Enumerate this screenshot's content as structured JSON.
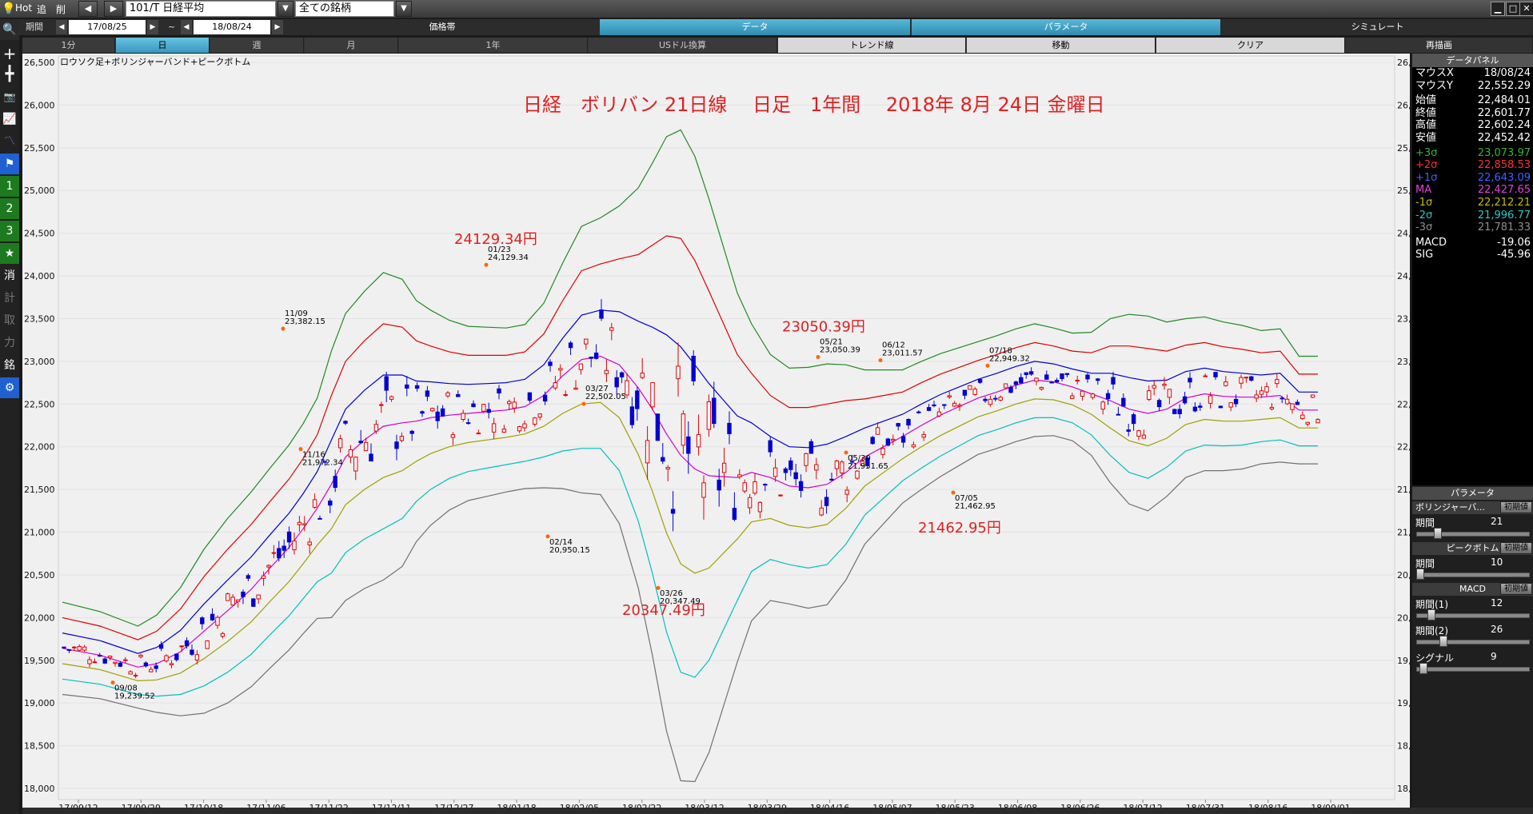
{
  "topbar": {
    "hot": "Hot",
    "add": "追",
    "del": "削",
    "code": "101/T 日経平均",
    "filter": "全ての銘柄"
  },
  "row2": {
    "period_label": "期間",
    "from_date": "17/08/25",
    "tilde": "~",
    "to_date": "18/08/24",
    "tabs": [
      "価格帯",
      "データ",
      "パラメータ",
      "シミュレート"
    ]
  },
  "row3": {
    "tabs": [
      "1分",
      "日",
      "週",
      "月",
      "1年",
      "USドル換算",
      "トレンド線",
      "移動",
      "クリア",
      "再描画"
    ]
  },
  "lefttoolbar": {
    "num1": "1",
    "num2": "2",
    "num3": "3",
    "k1": "消",
    "k2": "計",
    "k3": "取",
    "k4": "力",
    "k5": "銘"
  },
  "chart_data": {
    "type": "candlestick",
    "indicator_label": "ロウソク足+ボリンジャーバンド+ピークボトム",
    "title": "日経　ボリバン 21日線　 日足　1年間 　2018年 8月 24日 金曜日",
    "y_ticks": [
      "26,500",
      "26,000",
      "25,500",
      "25,000",
      "24,500",
      "24,000",
      "23,500",
      "23,000",
      "22,500",
      "22,000",
      "21,500",
      "21,000",
      "20,500",
      "20,000",
      "19,500",
      "19,000",
      "18,500",
      "18,000"
    ],
    "ylim": [
      18000,
      26500
    ],
    "x_ticks": [
      "17/09/12",
      "17/09/29",
      "17/10/18",
      "17/11/06",
      "17/11/22",
      "17/12/11",
      "17/12/27",
      "18/01/18",
      "18/02/05",
      "18/02/22",
      "18/03/12",
      "18/03/29",
      "18/04/16",
      "18/05/07",
      "18/05/23",
      "18/06/08",
      "18/06/26",
      "18/07/12",
      "18/07/31",
      "18/08/16",
      "18/09/01"
    ],
    "series_colors": {
      "+3σ": "#1e8c1e",
      "+2σ": "#e00000",
      "+1σ": "#0000d8",
      "MA": "#d000d0",
      "-1σ": "#a0a000",
      "-2σ": "#00c0c0",
      "-3σ": "#707070"
    },
    "peaks": [
      {
        "date": "09/08",
        "value": "19,239.52"
      },
      {
        "date": "11/09",
        "value": "23,382.15"
      },
      {
        "date": "11/16",
        "value": "21,972.34"
      },
      {
        "date": "01/23",
        "value": "24,129.34"
      },
      {
        "date": "02/14",
        "value": "20,950.15"
      },
      {
        "date": "03/27",
        "value": "22,502.05"
      },
      {
        "date": "03/26",
        "value": "20,347.49"
      },
      {
        "date": "05/21",
        "value": "23,050.39"
      },
      {
        "date": "05/30",
        "value": "21,931.65"
      },
      {
        "date": "06/12",
        "value": "23,011.57"
      },
      {
        "date": "07/05",
        "value": "21,462.95"
      },
      {
        "date": "07/18",
        "value": "22,949.32"
      }
    ],
    "callouts": [
      {
        "text": "24129.34円",
        "value": 24129.34
      },
      {
        "text": "23050.39円",
        "value": 23050.39
      },
      {
        "text": "20347.49円",
        "value": 20347.49
      },
      {
        "text": "21462.95円",
        "value": 21462.95
      }
    ],
    "bands": {
      "x": [
        0,
        40,
        80,
        100,
        125,
        150,
        175,
        200,
        220,
        240,
        255,
        270,
        285,
        300,
        320,
        340,
        360,
        375,
        390,
        410,
        430,
        450,
        470,
        490,
        510,
        530,
        550,
        570,
        590,
        610,
        625,
        640,
        655,
        670,
        685,
        700,
        715,
        730,
        750,
        770,
        790,
        810,
        830,
        850,
        870,
        890,
        910,
        930,
        950,
        970,
        990,
        1010,
        1030,
        1050,
        1070,
        1090,
        1110,
        1130,
        1150,
        1170,
        1190,
        1210,
        1230,
        1250,
        1270,
        1290,
        1310,
        1330
      ],
      "ma": [
        19640,
        19560,
        19420,
        19460,
        19600,
        19840,
        20080,
        20330,
        20580,
        20820,
        21040,
        21280,
        21560,
        21880,
        22080,
        22240,
        22280,
        22300,
        22340,
        22370,
        22390,
        22410,
        22430,
        22470,
        22600,
        22830,
        23020,
        23060,
        22960,
        22690,
        22440,
        22150,
        21900,
        21740,
        21660,
        21650,
        21640,
        21700,
        21640,
        21540,
        21520,
        21560,
        21700,
        21880,
        22000,
        22120,
        22250,
        22370,
        22470,
        22570,
        22640,
        22720,
        22780,
        22760,
        22700,
        22620,
        22540,
        22440,
        22390,
        22440,
        22570,
        22620,
        22590,
        22580,
        22580,
        22600,
        22430,
        22430
      ],
      "sd": [
        180,
        170,
        160,
        190,
        250,
        320,
        360,
        380,
        390,
        400,
        410,
        430,
        520,
        560,
        580,
        600,
        560,
        470,
        420,
        370,
        340,
        330,
        320,
        320,
        360,
        440,
        520,
        540,
        620,
        780,
        960,
        1160,
        1270,
        1220,
        1080,
        900,
        720,
        580,
        480,
        460,
        470,
        470,
        420,
        340,
        300,
        260,
        250,
        240,
        230,
        220,
        220,
        220,
        220,
        210,
        210,
        240,
        320,
        370,
        380,
        340,
        310,
        300,
        290,
        280,
        260,
        260,
        210,
        210
      ]
    }
  },
  "datapanel": {
    "title": "データパネル",
    "rows": [
      {
        "k": "マウスX",
        "v": "18/08/24",
        "color": "#ffffff"
      },
      {
        "k": "マウスY",
        "v": "22,552.29",
        "color": "#ffffff"
      },
      {
        "k": "始値",
        "v": "22,484.01",
        "color": "#ffffff"
      },
      {
        "k": "終値",
        "v": "22,601.77",
        "color": "#ffffff"
      },
      {
        "k": "高値",
        "v": "22,602.24",
        "color": "#ffffff"
      },
      {
        "k": "安値",
        "v": "22,452.42",
        "color": "#ffffff"
      },
      {
        "k": "+3σ",
        "v": "23,073.97",
        "color": "#3ab03a"
      },
      {
        "k": "+2σ",
        "v": "22,858.53",
        "color": "#ff3030"
      },
      {
        "k": "+1σ",
        "v": "22,643.09",
        "color": "#4060ff"
      },
      {
        "k": "MA",
        "v": "22,427.65",
        "color": "#e040e0"
      },
      {
        "k": "-1σ",
        "v": "22,212.21",
        "color": "#c0c000"
      },
      {
        "k": "-2σ",
        "v": "21,996.77",
        "color": "#30c8c8"
      },
      {
        "k": "-3σ",
        "v": "21,781.33",
        "color": "#909090"
      },
      {
        "k": "MACD",
        "v": "-19.06",
        "color": "#ffffff"
      },
      {
        "k": "SIG",
        "v": "-45.96",
        "color": "#ffffff"
      }
    ]
  },
  "params": {
    "title": "パラメータ",
    "init": "初期値",
    "bollinger": "ボリンジャーバ...",
    "b_period_label": "期間",
    "b_period": "21",
    "peakbottom": "ピークボトム",
    "pb_period_label": "期間",
    "pb_period": "10",
    "macd": "MACD",
    "m_p1_label": "期間(1)",
    "m_p1": "12",
    "m_p2_label": "期間(2)",
    "m_p2": "26",
    "m_sig_label": "シグナル",
    "m_sig": "9"
  }
}
